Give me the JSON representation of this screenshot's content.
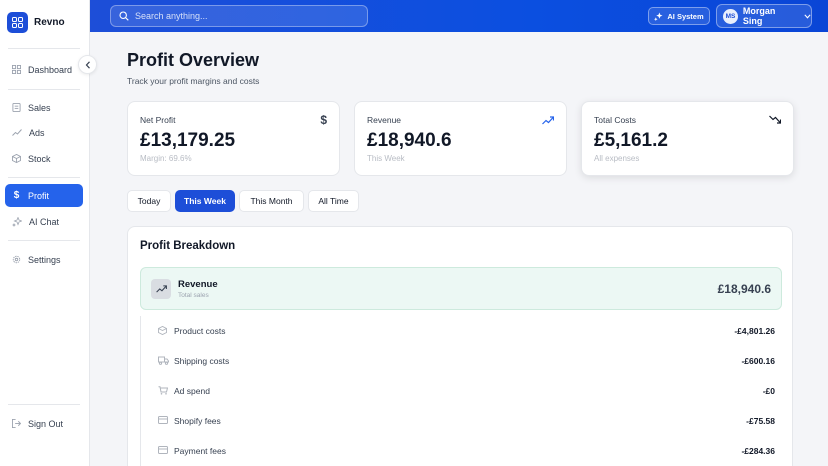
{
  "app": {
    "name": "Revno",
    "logo_glyph": "RB"
  },
  "sidebar": {
    "items": [
      {
        "label": "Dashboard",
        "icon": "layout-grid-icon"
      },
      {
        "label": "Sales",
        "icon": "receipt-icon"
      },
      {
        "label": "Ads",
        "icon": "trending-up-icon"
      },
      {
        "label": "Stock",
        "icon": "box-icon"
      },
      {
        "label": "Profit",
        "icon": "dollar-icon",
        "active": true
      },
      {
        "label": "AI Chat",
        "icon": "sparkles-icon"
      },
      {
        "label": "Settings",
        "icon": "gear-icon"
      }
    ],
    "sign_out": "Sign Out"
  },
  "topbar": {
    "search_placeholder": "Search anything...",
    "ai_button": "AI System",
    "user": {
      "initials": "MS",
      "name": "Morgan Sing"
    }
  },
  "page": {
    "title": "Profit Overview",
    "subtitle": "Track your profit margins and costs"
  },
  "cards": [
    {
      "label": "Net Profit",
      "value": "£13,179.25",
      "note": "Margin: 69.6%",
      "icon": "dollar-icon"
    },
    {
      "label": "Revenue",
      "value": "£18,940.6",
      "note": "This Week",
      "icon": "trending-up-icon"
    },
    {
      "label": "Total Costs",
      "value": "£5,161.2",
      "note": "All expenses",
      "icon": "trending-down-icon"
    }
  ],
  "tabs": [
    {
      "label": "Today"
    },
    {
      "label": "This Week",
      "active": true
    },
    {
      "label": "This Month"
    },
    {
      "label": "All Time"
    }
  ],
  "breakdown": {
    "title": "Profit Breakdown",
    "revenue": {
      "label": "Revenue",
      "sub": "Total sales",
      "amount": "£18,940.6"
    },
    "costs": [
      {
        "label": "Product costs",
        "value": "-£4,801.26",
        "icon": "box-icon"
      },
      {
        "label": "Shipping costs",
        "value": "-£600.16",
        "icon": "truck-icon"
      },
      {
        "label": "Ad spend",
        "value": "-£0",
        "icon": "cart-icon"
      },
      {
        "label": "Shopify fees",
        "value": "-£75.58",
        "icon": "card-icon"
      },
      {
        "label": "Payment fees",
        "value": "-£284.36",
        "icon": "card-icon"
      }
    ]
  },
  "colors": {
    "accent": "#2563eb",
    "topbar": "#0b4fe0",
    "revenue_bg": "#ecf8f4"
  }
}
